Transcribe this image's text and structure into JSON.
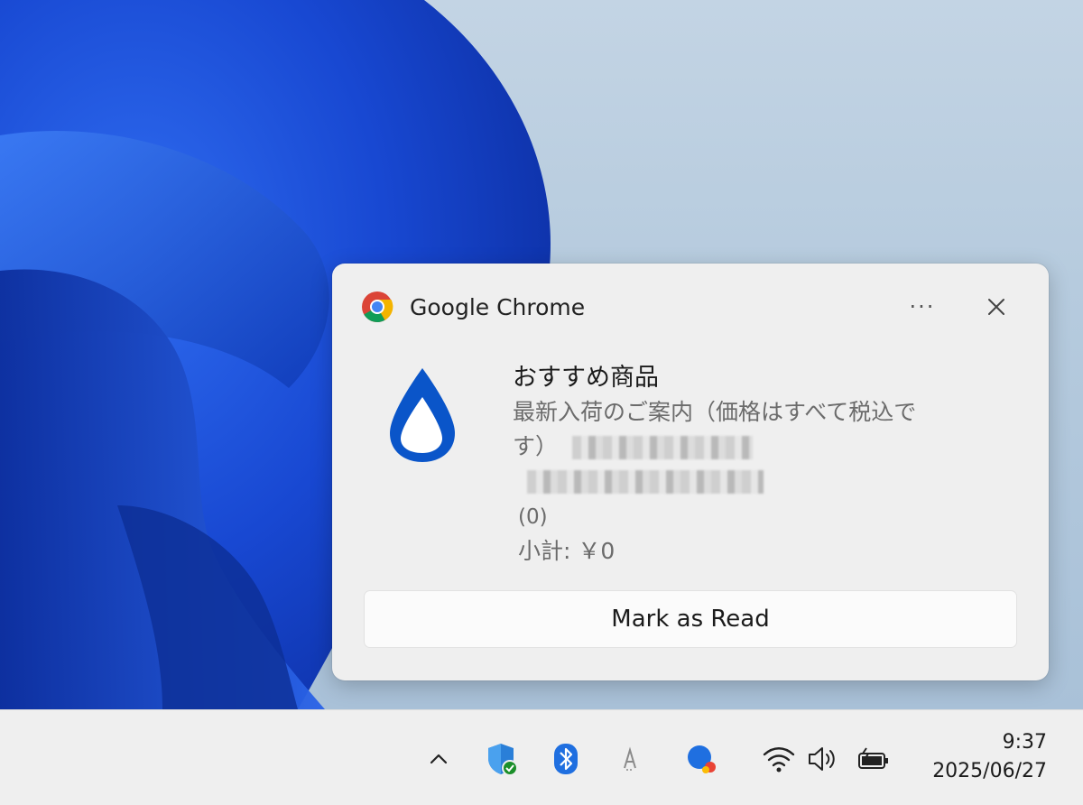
{
  "notification": {
    "app_name": "Google Chrome",
    "more_label": "···",
    "title": "おすすめ商品",
    "message_line1": "最新入荷のご案内（価格はすべて税込で",
    "message_line2": "す）",
    "count": "(0)",
    "subtotal": "小計: ￥0",
    "action_label": "Mark as Read",
    "icons": {
      "app": "chrome-icon",
      "hero": "water-drop-icon",
      "close": "close-icon",
      "more": "more-options-icon"
    }
  },
  "taskbar": {
    "time": "9:37",
    "date": "2025/06/27",
    "tray_icons": [
      "chevron-up-icon",
      "windows-security-icon",
      "bluetooth-icon",
      "ime-icon",
      "app-status-icon",
      "wifi-icon",
      "volume-icon",
      "battery-icon"
    ]
  },
  "colors": {
    "accent": "#0a55c9",
    "wallpaper_blue": "#1a4fd6",
    "toast_bg": "#efefef"
  }
}
